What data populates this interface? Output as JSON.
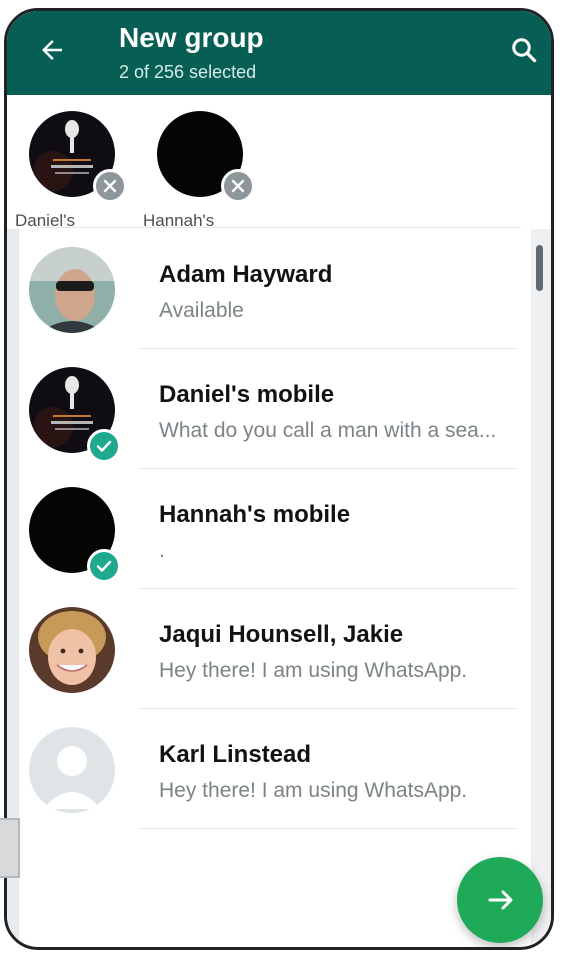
{
  "header": {
    "title": "New group",
    "subtitle": "2 of 256 selected",
    "color": "#075e54"
  },
  "selected": [
    {
      "name": "Daniel's"
    },
    {
      "name": "Hannah's"
    }
  ],
  "contacts": [
    {
      "name": "Adam Hayward",
      "status": "Available",
      "selected": false
    },
    {
      "name": "Daniel's mobile",
      "status": "What do you call a man with a sea...",
      "selected": true
    },
    {
      "name": "Hannah's mobile",
      "status": ".",
      "selected": true
    },
    {
      "name": "Jaqui Hounsell, Jakie",
      "status": "Hey there! I am using WhatsApp.",
      "selected": false
    },
    {
      "name": "Karl Linstead",
      "status": "Hey there! I am using WhatsApp.",
      "selected": false
    }
  ],
  "icons": {
    "back": "arrow-left-icon",
    "search": "search-icon",
    "next": "arrow-right-icon",
    "remove": "close-icon",
    "check": "check-icon"
  },
  "colors": {
    "accent": "#1fa98f",
    "fab": "#1faa59"
  }
}
